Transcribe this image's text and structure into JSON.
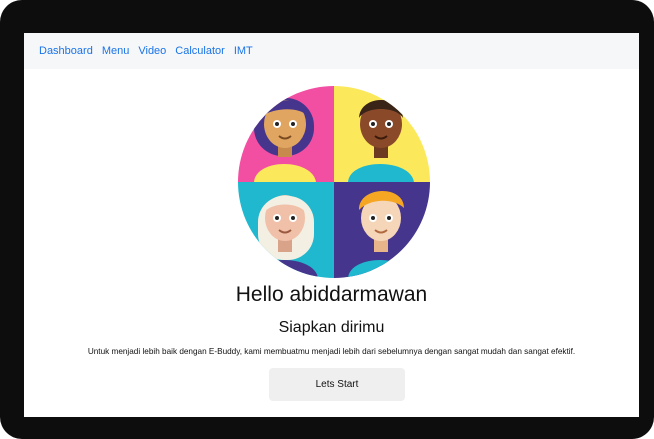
{
  "nav": {
    "items": [
      "Dashboard",
      "Menu",
      "Video",
      "Calculator",
      "IMT"
    ]
  },
  "hero": {
    "icon": "team-avatars-illustration",
    "colors": {
      "top_left_bg": "#f24fa3",
      "top_right_bg": "#fce95b",
      "bottom_left_bg": "#1fb8cf",
      "bottom_right_bg": "#45358c"
    }
  },
  "main": {
    "greeting": "Hello abiddarmawan",
    "subtitle": "Siapkan dirimu",
    "description": "Untuk menjadi lebih baik dengan E-Buddy, kami membuatmu menjadi lebih dari sebelumnya dengan sangat mudah dan sangat efektif.",
    "start_label": "Lets Start"
  },
  "colors": {
    "link": "#1a73e8",
    "navbar_bg": "#f6f7f9",
    "button_bg": "#efefef",
    "frame": "#0d0d0d"
  }
}
